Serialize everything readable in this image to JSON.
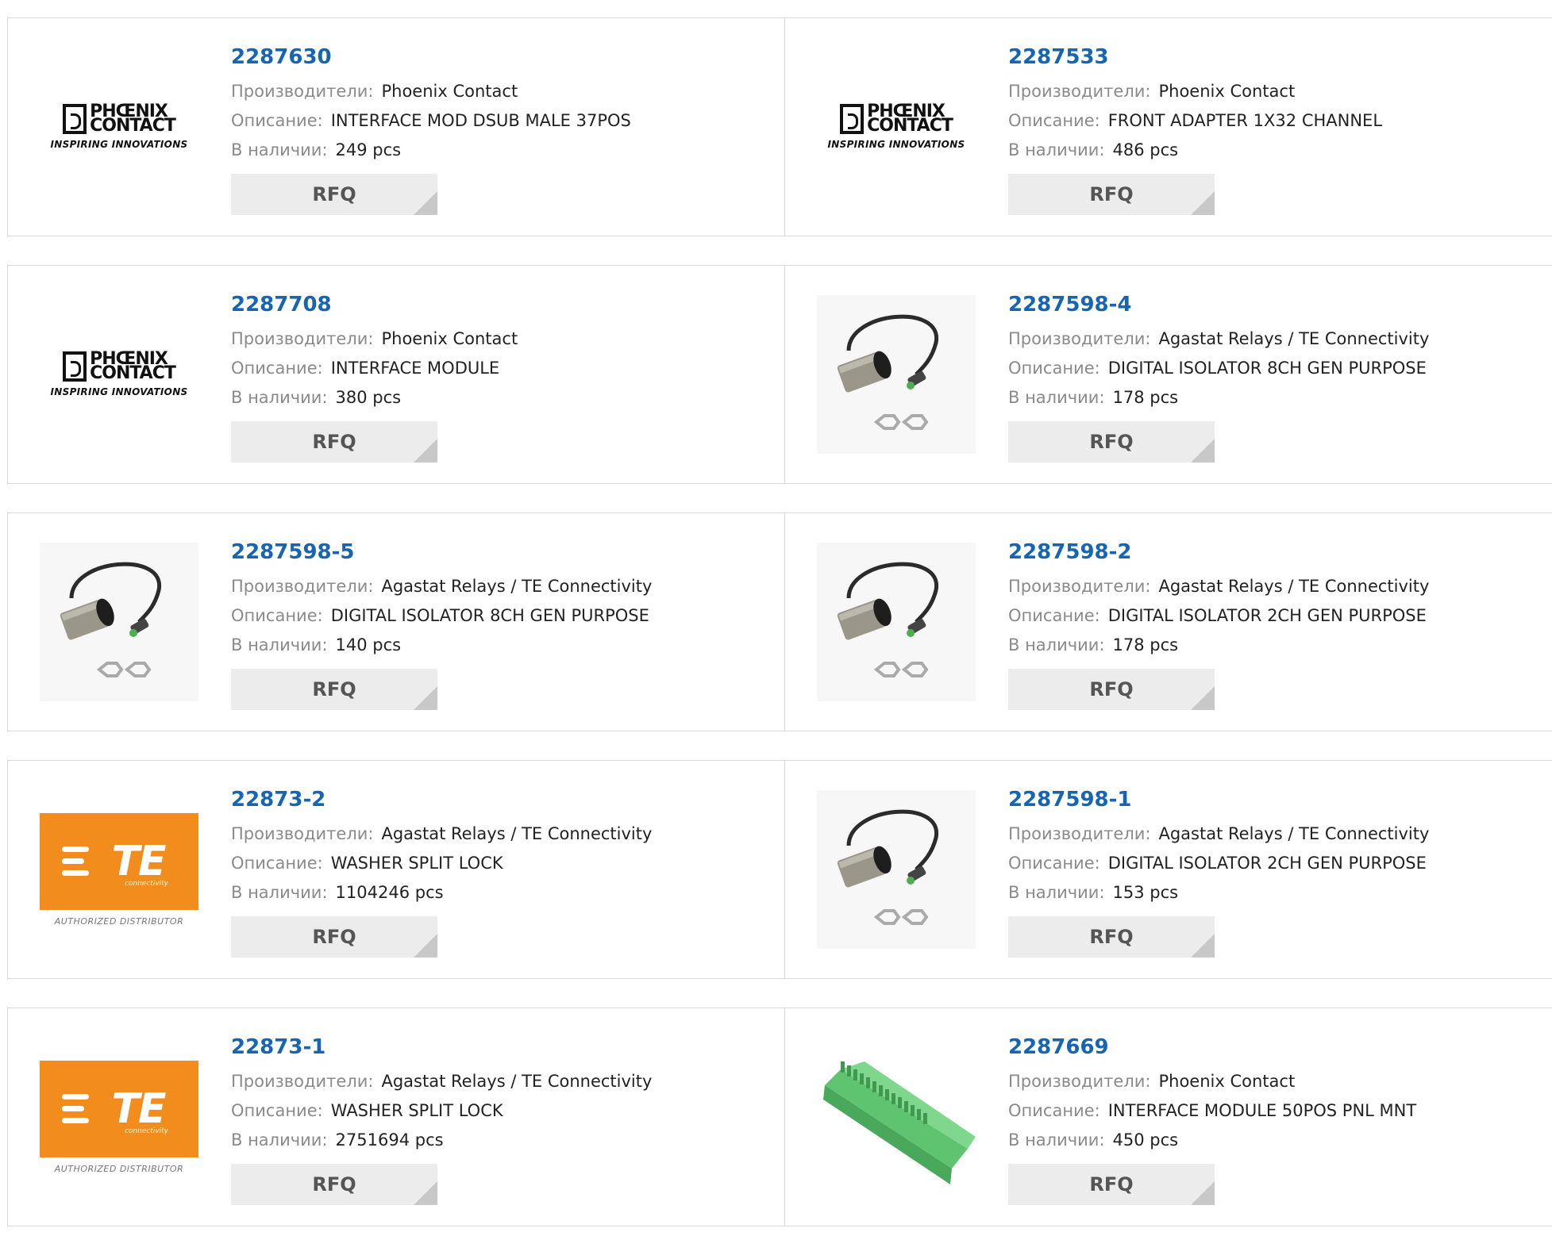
{
  "labels": {
    "manufacturer": "Производители:",
    "description": "Описание:",
    "stock": "В наличии:",
    "rfq": "RFQ"
  },
  "logos": {
    "phoenix_line1": "PHŒNIX",
    "phoenix_line2": "CONTACT",
    "phoenix_tagline": "INSPIRING INNOVATIONS",
    "te_text": "TE",
    "te_sub": "connectivity",
    "te_auth": "AUTHORIZED DISTRIBUTOR"
  },
  "products": [
    {
      "pn": "2287630",
      "manufacturer": "Phoenix Contact",
      "description": "INTERFACE MOD DSUB MALE 37POS",
      "stock": "249 pcs",
      "image": "phoenix-logo"
    },
    {
      "pn": "2287533",
      "manufacturer": "Phoenix Contact",
      "description": "FRONT ADAPTER 1X32 CHANNEL",
      "stock": "486 pcs",
      "image": "phoenix-logo"
    },
    {
      "pn": "2287708",
      "manufacturer": "Phoenix Contact",
      "description": "INTERFACE MODULE",
      "stock": "380 pcs",
      "image": "phoenix-logo"
    },
    {
      "pn": "2287598-4",
      "manufacturer": "Agastat Relays / TE Connectivity",
      "description": "DIGITAL ISOLATOR 8CH GEN PURPOSE",
      "stock": "178 pcs",
      "image": "sensor-photo"
    },
    {
      "pn": "2287598-5",
      "manufacturer": "Agastat Relays / TE Connectivity",
      "description": "DIGITAL ISOLATOR 8CH GEN PURPOSE",
      "stock": "140 pcs",
      "image": "sensor-photo"
    },
    {
      "pn": "2287598-2",
      "manufacturer": "Agastat Relays / TE Connectivity",
      "description": "DIGITAL ISOLATOR 2CH GEN PURPOSE",
      "stock": "178 pcs",
      "image": "sensor-photo"
    },
    {
      "pn": "22873-2",
      "manufacturer": "Agastat Relays / TE Connectivity",
      "description": "WASHER SPLIT LOCK",
      "stock": "1104246 pcs",
      "image": "te-logo"
    },
    {
      "pn": "2287598-1",
      "manufacturer": "Agastat Relays / TE Connectivity",
      "description": "DIGITAL ISOLATOR 2CH GEN PURPOSE",
      "stock": "153 pcs",
      "image": "sensor-photo"
    },
    {
      "pn": "22873-1",
      "manufacturer": "Agastat Relays / TE Connectivity",
      "description": "WASHER SPLIT LOCK",
      "stock": "2751694 pcs",
      "image": "te-logo"
    },
    {
      "pn": "2287669",
      "manufacturer": "Phoenix Contact",
      "description": "INTERFACE MODULE 50POS PNL MNT",
      "stock": "450 pcs",
      "image": "terminal-block-photo"
    }
  ],
  "colors": {
    "link": "#1565b4",
    "label": "#8a8a8a",
    "te_orange": "#f28c1c",
    "terminal_green": "#5fc470"
  }
}
